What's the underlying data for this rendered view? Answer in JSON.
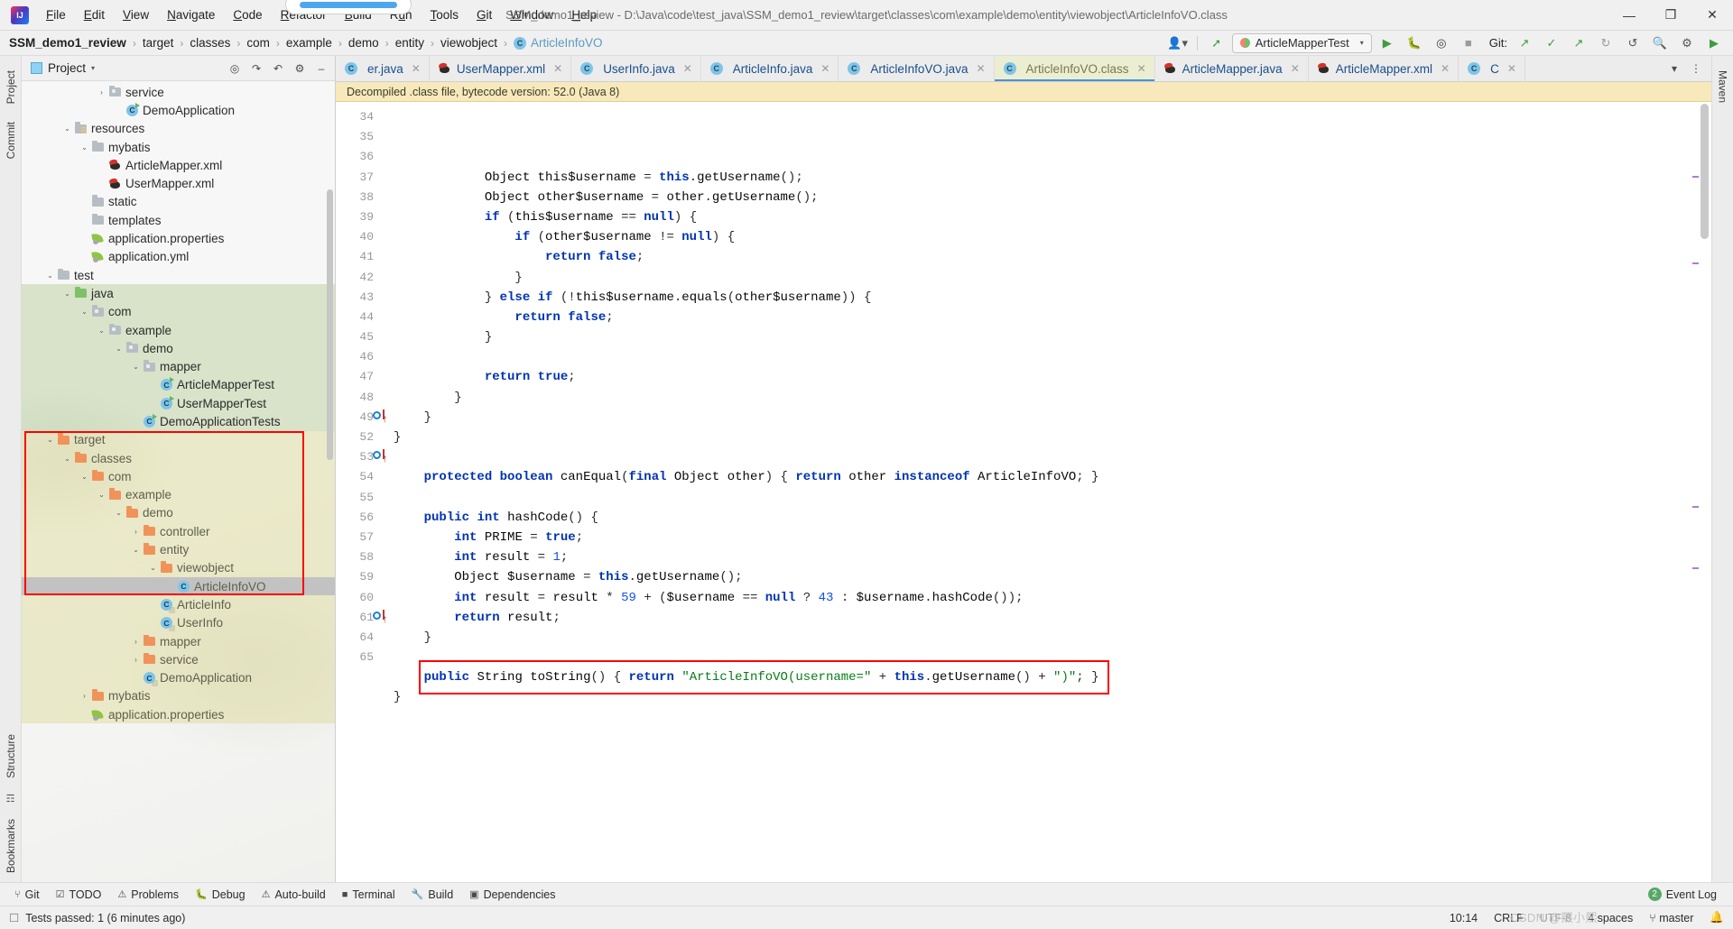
{
  "window": {
    "title": "SSM_demo1_review - D:\\Java\\code\\test_java\\SSM_demo1_review\\target\\classes\\com\\example\\demo\\entity\\viewobject\\ArticleInfoVO.class",
    "minimize": "—",
    "maximize": "❐",
    "close": "✕"
  },
  "menu": [
    "File",
    "Edit",
    "View",
    "Navigate",
    "Code",
    "Refactor",
    "Build",
    "Run",
    "Tools",
    "Git",
    "Window",
    "Help"
  ],
  "breadcrumb": {
    "items": [
      "SSM_demo1_review",
      "target",
      "classes",
      "com",
      "example",
      "demo",
      "entity",
      "viewobject"
    ],
    "current": "ArticleInfoVO",
    "current_icon": "class-icon",
    "separator": "›"
  },
  "nav_toolbar": {
    "user_icon": "user-icon",
    "search_everywhere_icon": "updates-icon",
    "run_config": "ArticleMapperTest",
    "run_icon": "run-icon",
    "debug_icon": "debug-icon",
    "coverage_icon": "coverage-icon",
    "stop_icon": "stop-icon",
    "git_label": "Git:",
    "git_update_icon": "git-update-icon",
    "git_commit_icon": "git-commit-icon",
    "git_push_icon": "git-push-icon",
    "history_icon": "history-icon",
    "undo_icon": "undo-icon",
    "search_icon": "search-icon",
    "settings_icon": "settings-icon",
    "play_green_icon": "play-green-icon"
  },
  "left_rail": [
    "Project",
    "Commit",
    "Structure",
    "Bookmarks"
  ],
  "right_rail": [
    "Maven"
  ],
  "project_panel": {
    "title": "Project",
    "caret": "▾",
    "tools": [
      "locate-icon",
      "expand-all-icon",
      "collapse-all-icon",
      "settings-icon",
      "hide-icon"
    ],
    "tree": [
      {
        "depth": 4,
        "arrow": "›",
        "icon": "folder-pkg",
        "label": "service",
        "row": "plain"
      },
      {
        "depth": 5,
        "arrow": "",
        "icon": "class-run",
        "label": "DemoApplication",
        "row": "plain"
      },
      {
        "depth": 2,
        "arrow": "⌄",
        "icon": "folder-res",
        "label": "resources",
        "row": "plain"
      },
      {
        "depth": 3,
        "arrow": "⌄",
        "icon": "folder",
        "label": "mybatis",
        "row": "plain"
      },
      {
        "depth": 4,
        "arrow": "",
        "icon": "xml",
        "label": "ArticleMapper.xml",
        "row": "plain"
      },
      {
        "depth": 4,
        "arrow": "",
        "icon": "xml",
        "label": "UserMapper.xml",
        "row": "plain"
      },
      {
        "depth": 3,
        "arrow": "",
        "icon": "folder",
        "label": "static",
        "row": "plain"
      },
      {
        "depth": 3,
        "arrow": "",
        "icon": "folder",
        "label": "templates",
        "row": "plain"
      },
      {
        "depth": 3,
        "arrow": "",
        "icon": "leaf",
        "label": "application.properties",
        "row": "plain"
      },
      {
        "depth": 3,
        "arrow": "",
        "icon": "leaf",
        "label": "application.yml",
        "row": "plain"
      },
      {
        "depth": 1,
        "arrow": "⌄",
        "icon": "folder",
        "label": "test",
        "row": "plain"
      },
      {
        "depth": 2,
        "arrow": "⌄",
        "icon": "folder-src",
        "label": "java",
        "row": "green"
      },
      {
        "depth": 3,
        "arrow": "⌄",
        "icon": "folder-pkg",
        "label": "com",
        "row": "green"
      },
      {
        "depth": 4,
        "arrow": "⌄",
        "icon": "folder-pkg",
        "label": "example",
        "row": "green"
      },
      {
        "depth": 5,
        "arrow": "⌄",
        "icon": "folder-pkg",
        "label": "demo",
        "row": "green"
      },
      {
        "depth": 6,
        "arrow": "⌄",
        "icon": "folder-pkg",
        "label": "mapper",
        "row": "green"
      },
      {
        "depth": 7,
        "arrow": "",
        "icon": "class-run",
        "label": "ArticleMapperTest",
        "row": "green"
      },
      {
        "depth": 7,
        "arrow": "",
        "icon": "class-run",
        "label": "UserMapperTest",
        "row": "green"
      },
      {
        "depth": 6,
        "arrow": "",
        "icon": "class-run",
        "label": "DemoApplicationTests",
        "row": "green"
      },
      {
        "depth": 1,
        "arrow": "⌄",
        "icon": "folder-out",
        "label": "target",
        "row": "olive"
      },
      {
        "depth": 2,
        "arrow": "⌄",
        "icon": "folder-out",
        "label": "classes",
        "row": "olive"
      },
      {
        "depth": 3,
        "arrow": "⌄",
        "icon": "folder-out",
        "label": "com",
        "row": "olive"
      },
      {
        "depth": 4,
        "arrow": "⌄",
        "icon": "folder-out",
        "label": "example",
        "row": "olive"
      },
      {
        "depth": 5,
        "arrow": "⌄",
        "icon": "folder-out",
        "label": "demo",
        "row": "olive"
      },
      {
        "depth": 6,
        "arrow": "›",
        "icon": "folder-out",
        "label": "controller",
        "row": "olive"
      },
      {
        "depth": 6,
        "arrow": "⌄",
        "icon": "folder-out",
        "label": "entity",
        "row": "olive"
      },
      {
        "depth": 7,
        "arrow": "⌄",
        "icon": "folder-out",
        "label": "viewobject",
        "row": "olive"
      },
      {
        "depth": 8,
        "arrow": "",
        "icon": "class-sh",
        "label": "ArticleInfoVO",
        "row": "selected"
      },
      {
        "depth": 7,
        "arrow": "",
        "icon": "class-sh",
        "label": "ArticleInfo",
        "row": "olive"
      },
      {
        "depth": 7,
        "arrow": "",
        "icon": "class-sh",
        "label": "UserInfo",
        "row": "olive"
      },
      {
        "depth": 6,
        "arrow": "›",
        "icon": "folder-out",
        "label": "mapper",
        "row": "olive"
      },
      {
        "depth": 6,
        "arrow": "›",
        "icon": "folder-out",
        "label": "service",
        "row": "olive"
      },
      {
        "depth": 6,
        "arrow": "",
        "icon": "class-sh",
        "label": "DemoApplication",
        "row": "olive"
      },
      {
        "depth": 3,
        "arrow": "›",
        "icon": "folder-out",
        "label": "mybatis",
        "row": "olive"
      },
      {
        "depth": 3,
        "arrow": "",
        "icon": "leaf",
        "label": "application.properties",
        "row": "olive"
      }
    ]
  },
  "tabs": [
    {
      "label": "er.java",
      "icon": "class-icon",
      "active": false,
      "clipped": true
    },
    {
      "label": "UserMapper.xml",
      "icon": "xml-icon",
      "active": false
    },
    {
      "label": "UserInfo.java",
      "icon": "class-icon",
      "active": false
    },
    {
      "label": "ArticleInfo.java",
      "icon": "class-icon",
      "active": false
    },
    {
      "label": "ArticleInfoVO.java",
      "icon": "class-icon",
      "active": false
    },
    {
      "label": "ArticleInfoVO.class",
      "icon": "class-icon",
      "active": true
    },
    {
      "label": "ArticleMapper.java",
      "icon": "xml-icon",
      "active": false
    },
    {
      "label": "ArticleMapper.xml",
      "icon": "xml-icon",
      "active": false
    },
    {
      "label": "C",
      "icon": "class-icon",
      "active": false,
      "clipped": true
    }
  ],
  "banner": "Decompiled .class file, bytecode version: 52.0 (Java 8)",
  "code": {
    "lines": [
      {
        "num": "34",
        "text": "            Object this$username = this.getUsername();"
      },
      {
        "num": "35",
        "text": "            Object other$username = other.getUsername();"
      },
      {
        "num": "36",
        "text": "            if (this$username == null) {"
      },
      {
        "num": "37",
        "text": "                if (other$username != null) {"
      },
      {
        "num": "38",
        "text": "                    return false;"
      },
      {
        "num": "39",
        "text": "                }"
      },
      {
        "num": "40",
        "text": "            } else if (!this$username.equals(other$username)) {"
      },
      {
        "num": "41",
        "text": "                return false;"
      },
      {
        "num": "42",
        "text": "            }"
      },
      {
        "num": "43",
        "text": ""
      },
      {
        "num": "44",
        "text": "            return true;"
      },
      {
        "num": "45",
        "text": "        }"
      },
      {
        "num": "46",
        "text": "    }"
      },
      {
        "num": "47",
        "text": "}"
      },
      {
        "num": "48",
        "text": ""
      },
      {
        "num": "49",
        "text": "    protected boolean canEqual(final Object other) { return other instanceof ArticleInfoVO; }"
      },
      {
        "num": "52",
        "text": ""
      },
      {
        "num": "53",
        "text": "    public int hashCode() {"
      },
      {
        "num": "54",
        "text": "        int PRIME = true;"
      },
      {
        "num": "55",
        "text": "        int result = 1;"
      },
      {
        "num": "56",
        "text": "        Object $username = this.getUsername();"
      },
      {
        "num": "57",
        "text": "        int result = result * 59 + ($username == null ? 43 : $username.hashCode());"
      },
      {
        "num": "58",
        "text": "        return result;"
      },
      {
        "num": "59",
        "text": "    }"
      },
      {
        "num": "60",
        "text": ""
      },
      {
        "num": "61",
        "text": "    public String toString() { return \"ArticleInfoVO(username=\" + this.getUsername() + \")\"; }"
      },
      {
        "num": "64",
        "text": "}"
      },
      {
        "num": "65",
        "text": ""
      }
    ]
  },
  "bottom_bar": {
    "items": [
      {
        "label": "Git",
        "icon": "git-icon"
      },
      {
        "label": "TODO",
        "icon": "todo-icon"
      },
      {
        "label": "Problems",
        "icon": "problems-icon"
      },
      {
        "label": "Debug",
        "icon": "debug-icon"
      },
      {
        "label": "Auto-build",
        "icon": "autobuild-icon"
      },
      {
        "label": "Terminal",
        "icon": "terminal-icon"
      },
      {
        "label": "Build",
        "icon": "build-icon"
      },
      {
        "label": "Dependencies",
        "icon": "dependencies-icon"
      }
    ],
    "event_log": "Event Log",
    "event_count": "2"
  },
  "status_bar": {
    "left_icon": "tests-icon",
    "left_text": "Tests passed: 1 (6 minutes ago)",
    "position": "10:14",
    "line_separator": "CRLF",
    "encoding": "UTF-8",
    "indent": "4 spaces",
    "branch": "master",
    "branch_icon": "branch-icon",
    "watermark": "CSDN @熙小熙"
  },
  "colors": {
    "accent_blue": "#4a90d9",
    "red_highlight": "#ff0000",
    "keyword": "#0033b3",
    "string": "#067d17",
    "number": "#1750eb",
    "active_tab_bg": "#eceed2",
    "selection": "#c2c2c2"
  }
}
